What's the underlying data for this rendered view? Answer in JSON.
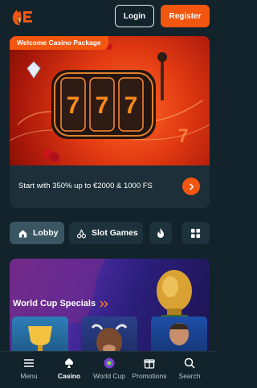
{
  "header": {
    "login_label": "Login",
    "register_label": "Register",
    "colors": {
      "brand": "#f2560f",
      "background": "#13232b"
    }
  },
  "promo": {
    "badge": "Welcome Casino Package",
    "text": "Start with 350% up to €2000 & 1000 FS",
    "icon": "chevron-right-icon"
  },
  "tabs": [
    {
      "label": "Lobby",
      "icon": "home-icon",
      "active": true
    },
    {
      "label": "Slot Games",
      "icon": "cherry-icon",
      "active": false
    },
    {
      "label": "",
      "icon": "flame-icon",
      "active": false
    },
    {
      "label": "",
      "icon": "grid-icon",
      "active": false
    }
  ],
  "world_cup": {
    "title": "World Cup Specials",
    "icon": "double-chevron-right-icon"
  },
  "bottom_nav": [
    {
      "label": "Menu",
      "icon": "menu-icon",
      "active": false
    },
    {
      "label": "Casino",
      "icon": "casino-chip-icon",
      "active": true
    },
    {
      "label": "World Cup",
      "icon": "world-cup-icon",
      "active": false
    },
    {
      "label": "Promotions",
      "icon": "gift-icon",
      "active": false
    },
    {
      "label": "Search",
      "icon": "search-icon",
      "active": false
    }
  ]
}
